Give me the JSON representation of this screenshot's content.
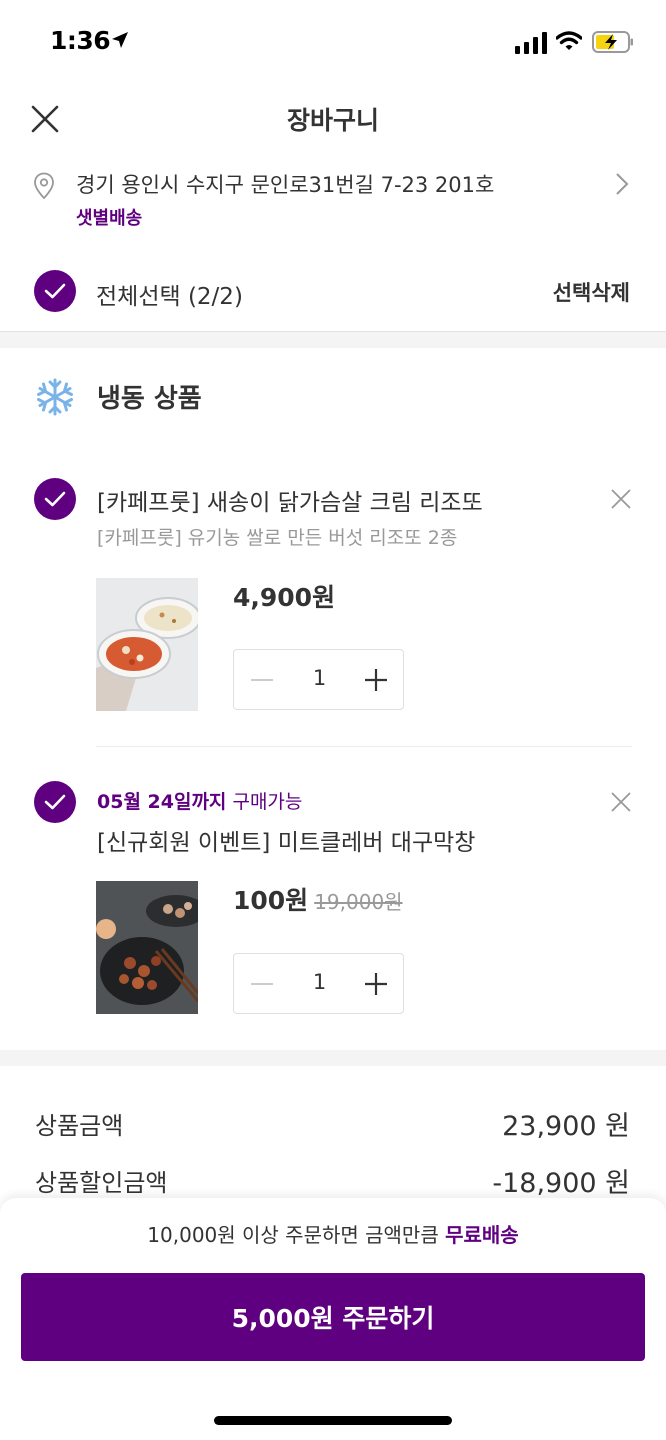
{
  "status": {
    "time": "1:36"
  },
  "header": {
    "title": "장바구니"
  },
  "address": {
    "text": "경기 용인시 수지구 문인로31번길 7-23 201호",
    "delivery_type": "샛별배송"
  },
  "select": {
    "all_label": "전체선택 (2/2)",
    "delete_label": "선택삭제"
  },
  "section": {
    "title": "냉동 상품",
    "icon": "snowflake-icon"
  },
  "items": [
    {
      "title": "[카페프룻] 새송이 닭가슴살 크림 리조또",
      "subtitle": "[카페프룻] 유기농 쌀로 만든 버섯 리조또 2종",
      "price": "4,900원",
      "quantity": "1"
    },
    {
      "deadline_date": "05월 24일까지",
      "deadline_text": "구매가능",
      "title": "[신규회원 이벤트] 미트클레버 대구막창",
      "price": "100원",
      "original_price": "19,000원",
      "quantity": "1"
    }
  ],
  "summary": [
    {
      "label": "상품금액",
      "value": "23,900 원"
    },
    {
      "label": "상품할인금액",
      "value": "-18,900 원"
    }
  ],
  "footer": {
    "note_prefix": "10,000원 이상 주문하면 금액만큼",
    "note_highlight": "무료배송",
    "order_button": "5,000원 주문하기"
  },
  "colors": {
    "accent": "#5f0080",
    "text": "#333333",
    "muted": "#999999"
  }
}
